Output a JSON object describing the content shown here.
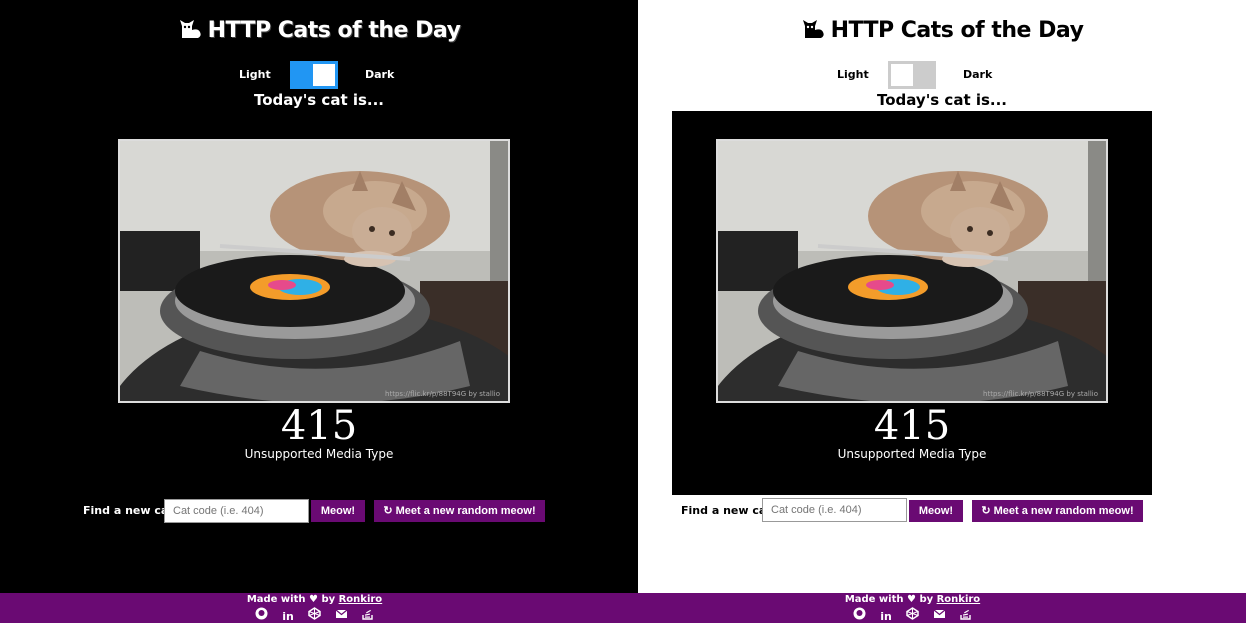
{
  "app": {
    "title": "HTTP Cats of the Day",
    "toggle_light": "Light",
    "toggle_dark": "Dark",
    "today_label": "Today's cat is..."
  },
  "cat": {
    "code": "415",
    "description": "Unsupported Media Type",
    "photo_credit": "https://flic.kr/p/88T94G by stallio"
  },
  "search": {
    "label": "Find a new cat:",
    "placeholder": "Cat code (i.e. 404)",
    "meow_button": "Meow!",
    "random_button": "Meet a new random meow!"
  },
  "footer": {
    "made_with": "Made with",
    "by": "by",
    "author": "Ronkiro"
  },
  "panels": {
    "dark": {
      "toggle_state": "dark"
    },
    "light": {
      "toggle_state": "light"
    }
  }
}
